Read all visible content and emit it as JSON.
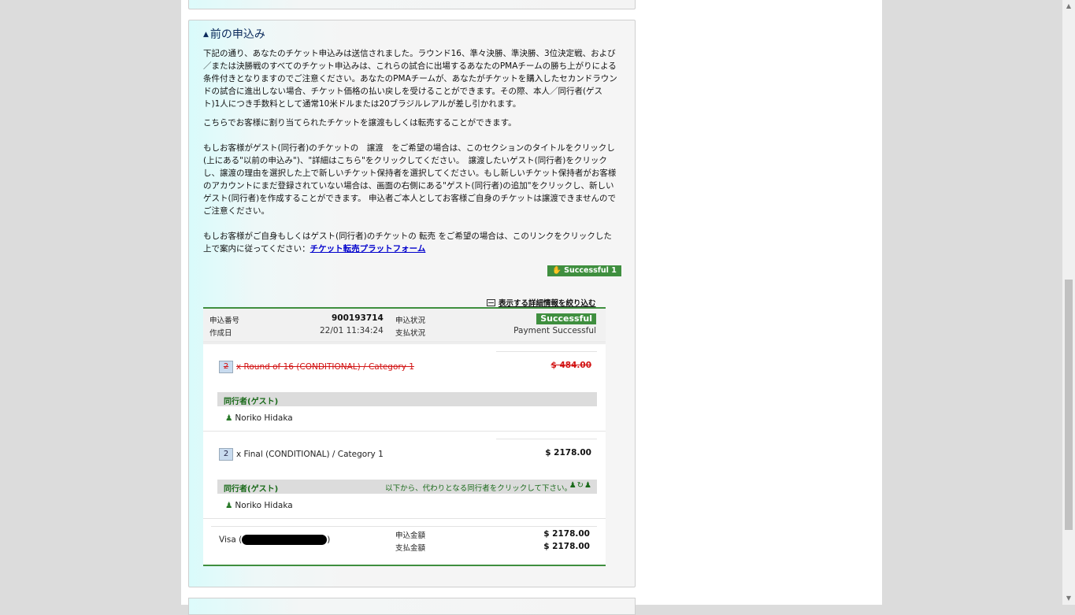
{
  "section": {
    "title": "前の申込み",
    "para1": "下記の通り、あなたのチケット申込みは送信されました。ラウンド16、準々決勝、準決勝、3位決定戦、および／または決勝戦のすべてのチケット申込みは、これらの試合に出場するあなたのPMAチームの勝ち上がりによる条件付きとなりますのでご注意ください。あなたのPMAチームが、あなたがチケットを購入したセカンドラウンドの試合に進出しない場合、チケット価格の払い戻しを受けることができます。その際、本人／同行者(ゲスト)1人につき手数料として通常10米ドルまたは20ブラジルレアルが差し引かれます。",
    "para2": "こちらでお客様に割り当てられたチケットを譲渡もしくは転売することができます。",
    "para3": "もしお客様がゲスト(同行者)のチケットの　譲渡　をご希望の場合は、このセクションのタイトルをクリックし(上にある\"以前の申込み\")、\"詳細はこちら\"をクリックしてください。　譲渡したいゲスト(同行者)をクリックし、譲渡の理由を選択した上で新しいチケット保持者を選択してください。もし新しいチケット保持者がお客様のアカウントにまだ登録されていない場合は、画面の右側にある\"ゲスト(同行者)の追加\"をクリックし、新しいゲスト(同行者)を作成することができます。 申込者ご本人としてお客様ご自身のチケットは譲渡できませんのでご注意ください。",
    "para4": "もしお客様がご自身もしくはゲスト(同行者)のチケットの 転売 をご希望の場合は、このリンクをクリックした上で案内に従ってください：",
    "resale_link": "チケット転売プラットフォーム",
    "success_badge": "Successful 1",
    "filter_link": "表示する詳細情報を絞り込む"
  },
  "order": {
    "number_label": "申込番号",
    "number": "900193714",
    "date_label": "作成日",
    "date": "22/01 11:34:24",
    "status_label": "申込状況",
    "status": "Successful",
    "payment_label": "支払状況",
    "payment_status": "Payment Successful",
    "items": [
      {
        "qty": "2",
        "desc": "x Round of 16 (CONDITIONAL) / Category 1",
        "price": "$  484.00",
        "guest_header": "同行者(ゲスト)",
        "guest": "Noriko Hidaka"
      },
      {
        "qty": "2",
        "desc": "x Final (CONDITIONAL) / Category 1",
        "price": "$  2178.00",
        "guest_header": "同行者(ゲスト)",
        "guest_hint": "以下から、代わりとなる同行者をクリックして下さい。",
        "guest": "Noriko Hidaka"
      }
    ],
    "payment_method": "Visa (",
    "payment_method_end": ")",
    "amount_label": "申込金額",
    "amount": "$  2178.00",
    "paid_label": "支払金額",
    "paid": "$  2178.00"
  }
}
